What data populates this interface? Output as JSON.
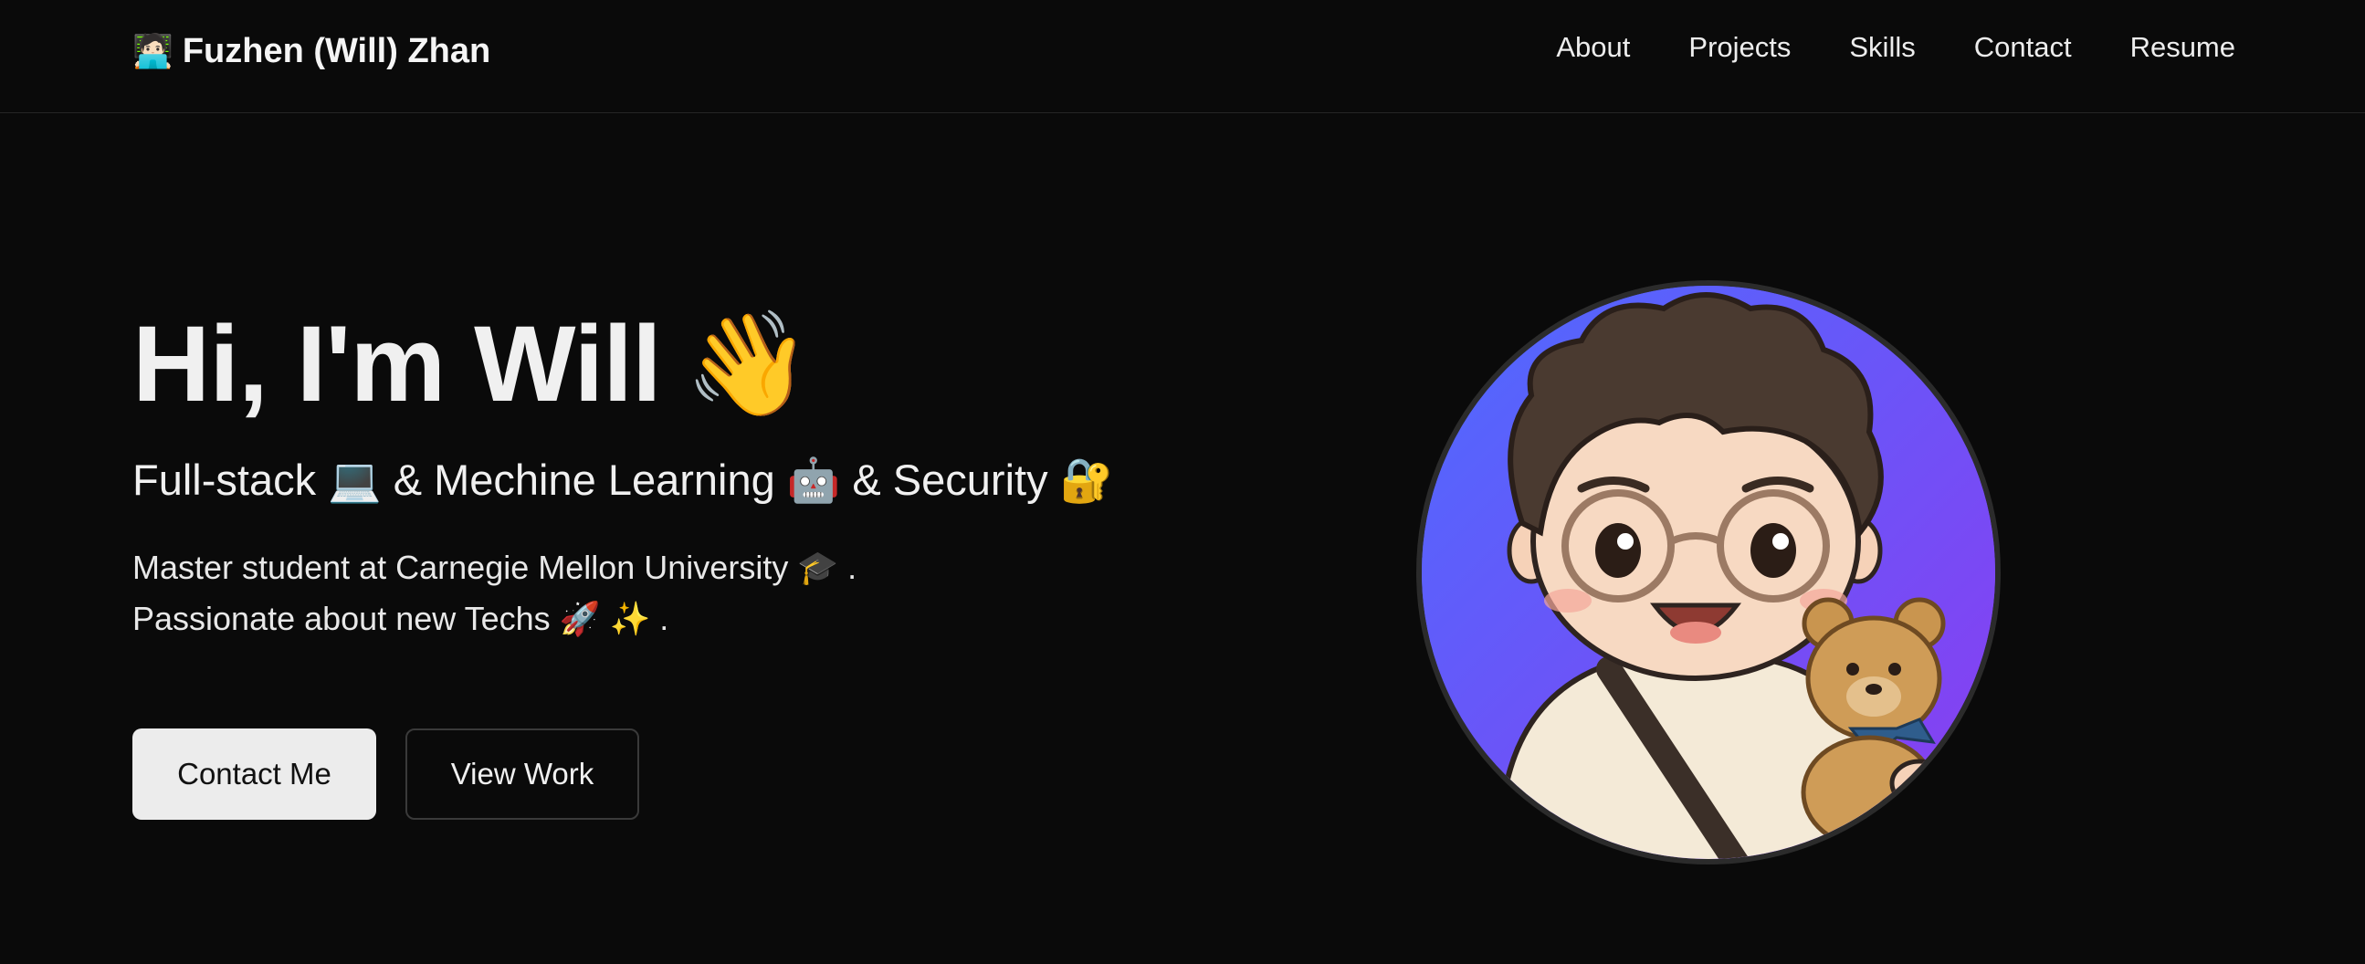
{
  "nav": {
    "brand_emoji": "🧑🏻‍💻",
    "brand_name": "Fuzhen (Will) Zhan",
    "links": [
      "About",
      "Projects",
      "Skills",
      "Contact",
      "Resume"
    ]
  },
  "hero": {
    "greeting": "Hi, I'm Will",
    "wave_emoji": "👋",
    "subtitle": "Full-stack 💻 & Mechine Learning 🤖 & Security 🔐",
    "desc_line1": "Master student at Carnegie Mellon University 🎓 .",
    "desc_line2": "Passionate about new Techs 🚀 ✨ ."
  },
  "buttons": {
    "contact": "Contact Me",
    "view_work": "View Work"
  },
  "colors": {
    "background": "#0a0a0a",
    "primary_button": "#ececec",
    "avatar_gradient_start": "#4d6bff",
    "avatar_gradient_end": "#8b3cf0"
  }
}
